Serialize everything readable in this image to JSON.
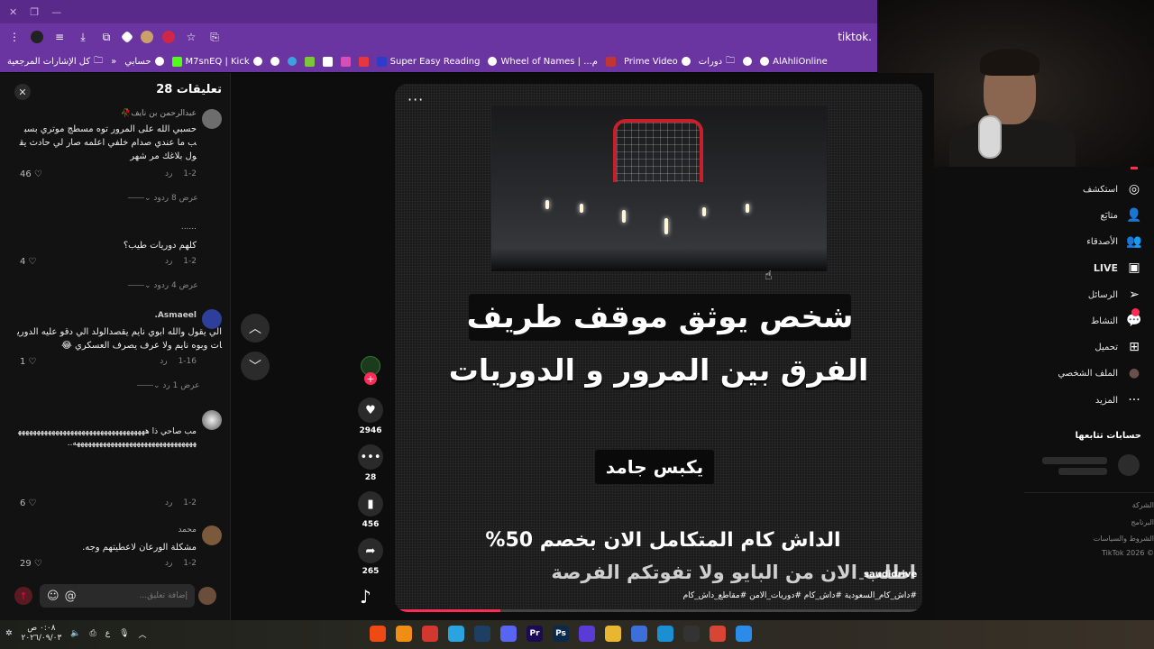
{
  "browser": {
    "url": "tiktok.",
    "bookmarks": [
      {
        "label": "كل الإشارات المرجعية",
        "kind": "folder"
      },
      {
        "label": "حسابي",
        "kind": "globe"
      },
      {
        "label": "M7snEQ | Kick",
        "kind": "globe"
      },
      {
        "label": "Super Easy Reading",
        "kind": "globe"
      },
      {
        "label": "Wheel of Names | ...م",
        "kind": "globe"
      },
      {
        "label": "Prime Video",
        "kind": "globe"
      },
      {
        "label": "دورات",
        "kind": "folder"
      },
      {
        "label": "AlAhliOnline",
        "kind": "globe"
      }
    ]
  },
  "comments_panel": {
    "title": "تعليقات 28",
    "input_placeholder": "إضافة تعليق...",
    "comments": [
      {
        "user": "عبدالرحمن بن نايف🥀",
        "text": "حسبي الله على المرور توه مسطج موتري بسبب ما عندي صدام خلفي اعلمه صار لي حادث يقول بلاغك مر شهر",
        "date": "1-2",
        "reply": "رد",
        "likes": "46",
        "replies_label": "عرض 8 ردود",
        "avatar_color": "#6d6d6d"
      },
      {
        "user": "......",
        "text": "كلهم دوريات طيب؟",
        "date": "1-2",
        "reply": "رد",
        "likes": "4",
        "replies_label": "عرض 4 ردود",
        "avatar_color": "#121212"
      },
      {
        "user": "Asmaeel.",
        "text": "الي يقول والله ابوي نايم يقصدالولد الي دقو عليه الدوريات وبوه نايم ولا عرف يصرف العسكري 😂",
        "date": "1-16",
        "reply": "رد",
        "likes": "1",
        "replies_label": "عرض 1 رد",
        "avatar_color": "#2d3f9a"
      },
      {
        "user": "￼",
        "text": "مب صاحي ذا\nهههههههههههههههههههههههههههههههههههههههههههههههههههههههههههههههههههه..",
        "date": "1-2",
        "reply": "رد",
        "likes": "6",
        "avatar_color": "#9a9a9a"
      },
      {
        "user": "محمد",
        "text": "مشكلة الورعان لاعطيتهم وجه.",
        "date": "1-2",
        "reply": "رد",
        "likes": "29",
        "avatar_color": "#7a5a3a"
      }
    ]
  },
  "video": {
    "headline": "شخص يوثق موقف طريف",
    "subhead": "الفرق بين المرور و الدوريات",
    "mid_caption": "يكبس جامد",
    "promo_line1": "الداش كام المتكامل الان بخصم 50%",
    "promo_line2": "اطلب الان من البايو ولا تفوتكم الفرصة",
    "author": "_saudidrive",
    "hashtags": "#داش_كام_السعودية #داش_كام #دوريات_الامن #مقاطع_داش_كام",
    "more": "···",
    "progress": 0.2
  },
  "actions": {
    "likes": "2946",
    "comments": "28",
    "saves": "456",
    "shares": "265"
  },
  "sidebar": {
    "items": [
      {
        "label": "استكشف",
        "icon": "compass-icon",
        "glyph": "◎"
      },
      {
        "label": "متابَع",
        "icon": "following-icon",
        "glyph": "👤"
      },
      {
        "label": "الأصدقاء",
        "icon": "friends-icon",
        "glyph": "👥"
      },
      {
        "label": "LIVE",
        "icon": "live-icon",
        "glyph": "▣"
      },
      {
        "label": "الرسائل",
        "icon": "messages-icon",
        "glyph": "➢"
      },
      {
        "label": "النشاط",
        "icon": "activity-icon",
        "glyph": "💬"
      },
      {
        "label": "تحميل",
        "icon": "upload-icon",
        "glyph": "⊞"
      },
      {
        "label": "الملف الشخصي",
        "icon": "profile-icon",
        "glyph": "●"
      },
      {
        "label": "المزيد",
        "icon": "more-icon",
        "glyph": "···"
      }
    ],
    "following_heading": "حسابات تتابعها",
    "footer": [
      "الشركة",
      "البرنامج",
      "الشروط والسياسات",
      "© 2026 TikTok"
    ]
  },
  "taskbar": {
    "time": "٠:٠٨ ص",
    "date": "٢٠٢٦/٠٩/٠٣",
    "lang": "ع",
    "apps": [
      {
        "name": "brave-app",
        "color": "#f04a14",
        "label": ""
      },
      {
        "name": "vlc-app",
        "color": "#f08d14",
        "label": ""
      },
      {
        "name": "app-red",
        "color": "#d2382f",
        "label": ""
      },
      {
        "name": "telegram-app",
        "color": "#2aa3df",
        "label": ""
      },
      {
        "name": "steam-app",
        "color": "#1f3e63",
        "label": ""
      },
      {
        "name": "discord-app",
        "color": "#5865f2",
        "label": ""
      },
      {
        "name": "premiere-app",
        "color": "#1c0a55",
        "label": "Pr"
      },
      {
        "name": "photoshop-app",
        "color": "#0b2a4a",
        "label": "Ps"
      },
      {
        "name": "app-purple",
        "color": "#5b3bd6",
        "label": ""
      },
      {
        "name": "explorer-app",
        "color": "#e8b631",
        "label": ""
      },
      {
        "name": "store-app",
        "color": "#3d6fd8",
        "label": ""
      },
      {
        "name": "edge-app",
        "color": "#1a8fd1",
        "label": ""
      },
      {
        "name": "obs-app",
        "color": "#333333",
        "label": ""
      },
      {
        "name": "chrome-app",
        "color": "#d94535",
        "label": ""
      },
      {
        "name": "windows-start",
        "color": "#2a8ce8",
        "label": ""
      }
    ]
  }
}
